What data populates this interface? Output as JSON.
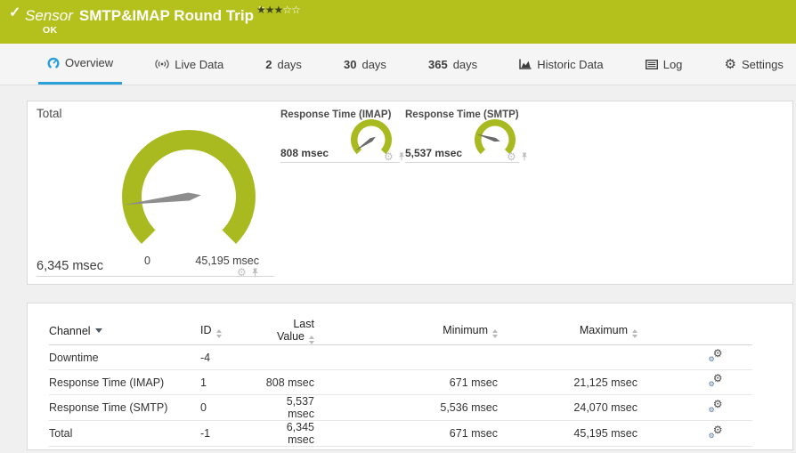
{
  "colors": {
    "green": "#b4c11d",
    "gauge_green": "#a8ba1f",
    "accent": "#2a9fd8"
  },
  "header": {
    "sensor_word": "Sensor",
    "title": "SMTP&IMAP Round Trip",
    "status": "OK",
    "priority": {
      "filled": 3,
      "total": 5
    }
  },
  "tabs": [
    {
      "label": "Overview",
      "icon": "gauge-icon",
      "active": true
    },
    {
      "label": "Live Data",
      "icon": "live-data-icon",
      "active": false
    },
    {
      "num": "2",
      "label": "days",
      "active": false
    },
    {
      "num": "30",
      "label": "days",
      "active": false
    },
    {
      "num": "365",
      "label": "days",
      "active": false
    },
    {
      "label": "Historic Data",
      "icon": "historic-data-icon",
      "active": false
    },
    {
      "label": "Log",
      "icon": "log-icon",
      "active": false
    },
    {
      "label": "Settings",
      "icon": "settings-icon",
      "active": false
    }
  ],
  "chart_data": [
    {
      "type": "gauge",
      "title": "Total",
      "value": 6345,
      "min": 0,
      "max": 45195,
      "unit": "msec",
      "value_display": "6,345 msec",
      "min_label": "0",
      "max_label": "45,195 msec",
      "sweep_degrees": 270
    },
    {
      "type": "gauge",
      "title": "Response Time (IMAP)",
      "value": 808,
      "min": 0,
      "max": 21125,
      "unit": "msec",
      "value_display": "808 msec",
      "sweep_degrees": 270
    },
    {
      "type": "gauge",
      "title": "Response Time (SMTP)",
      "value": 5537,
      "min": 0,
      "max": 24070,
      "unit": "msec",
      "value_display": "5,537 msec",
      "sweep_degrees": 270
    }
  ],
  "table": {
    "columns": [
      "Channel",
      "ID",
      "Last Value",
      "Minimum",
      "Maximum"
    ],
    "rows": [
      {
        "channel": "Downtime",
        "id": "-4",
        "last_value": "",
        "minimum": "",
        "maximum": ""
      },
      {
        "channel": "Response Time (IMAP)",
        "id": "1",
        "last_value": "808 msec",
        "minimum": "671 msec",
        "maximum": "21,125 msec"
      },
      {
        "channel": "Response Time (SMTP)",
        "id": "0",
        "last_value": "5,537 msec",
        "minimum": "5,536 msec",
        "maximum": "24,070 msec"
      },
      {
        "channel": "Total",
        "id": "-1",
        "last_value": "6,345 msec",
        "minimum": "671 msec",
        "maximum": "45,195 msec"
      }
    ]
  }
}
